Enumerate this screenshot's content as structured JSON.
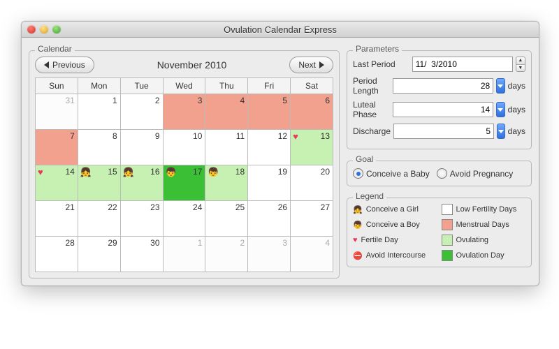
{
  "window": {
    "title": "Ovulation Calendar Express"
  },
  "calendar": {
    "group_label": "Calendar",
    "prev": "Previous",
    "next": "Next",
    "title": "November 2010",
    "weekdays": [
      "Sun",
      "Mon",
      "Tue",
      "Wed",
      "Thu",
      "Fri",
      "Sat"
    ],
    "cells": [
      {
        "n": "31",
        "cls": "outside"
      },
      {
        "n": "1"
      },
      {
        "n": "2"
      },
      {
        "n": "3",
        "cls": "menstrual"
      },
      {
        "n": "4",
        "cls": "menstrual"
      },
      {
        "n": "5",
        "cls": "menstrual"
      },
      {
        "n": "6",
        "cls": "menstrual"
      },
      {
        "n": "7",
        "cls": "menstrual"
      },
      {
        "n": "8"
      },
      {
        "n": "9"
      },
      {
        "n": "10"
      },
      {
        "n": "11"
      },
      {
        "n": "12"
      },
      {
        "n": "13",
        "cls": "fertile",
        "icon": "heart",
        "iconChar": "♥"
      },
      {
        "n": "14",
        "cls": "fertile",
        "icon": "heart",
        "iconChar": "♥"
      },
      {
        "n": "15",
        "cls": "fertile",
        "icon": "girl",
        "iconChar": "👧"
      },
      {
        "n": "16",
        "cls": "fertile",
        "icon": "girl",
        "iconChar": "👧"
      },
      {
        "n": "17",
        "cls": "ovday",
        "icon": "boy",
        "iconChar": "👦"
      },
      {
        "n": "18",
        "cls": "fertile",
        "icon": "boy",
        "iconChar": "👦"
      },
      {
        "n": "19"
      },
      {
        "n": "20"
      },
      {
        "n": "21"
      },
      {
        "n": "22"
      },
      {
        "n": "23"
      },
      {
        "n": "24"
      },
      {
        "n": "25"
      },
      {
        "n": "26"
      },
      {
        "n": "27"
      },
      {
        "n": "28"
      },
      {
        "n": "29"
      },
      {
        "n": "30"
      },
      {
        "n": "1",
        "cls": "outside"
      },
      {
        "n": "2",
        "cls": "outside"
      },
      {
        "n": "3",
        "cls": "outside"
      },
      {
        "n": "4",
        "cls": "outside"
      }
    ]
  },
  "parameters": {
    "group_label": "Parameters",
    "last_period_label": "Last Period",
    "last_period_value": "11/  3/2010",
    "period_length_label": "Period Length",
    "period_length_value": "28",
    "luteal_label": "Luteal Phase",
    "luteal_value": "14",
    "discharge_label": "Discharge",
    "discharge_value": "5",
    "days_unit": "days"
  },
  "goal": {
    "group_label": "Goal",
    "conceive": "Conceive a Baby",
    "avoid": "Avoid Pregnancy",
    "selected": "conceive"
  },
  "legend": {
    "group_label": "Legend",
    "girl": "Conceive a Girl",
    "boy": "Conceive a Boy",
    "fertile": "Fertile Day",
    "avoid": "Avoid Intercourse",
    "low": "Low Fertility Days",
    "menstrual": "Menstrual Days",
    "ovulating": "Ovulating",
    "ovday": "Ovulation Day"
  }
}
